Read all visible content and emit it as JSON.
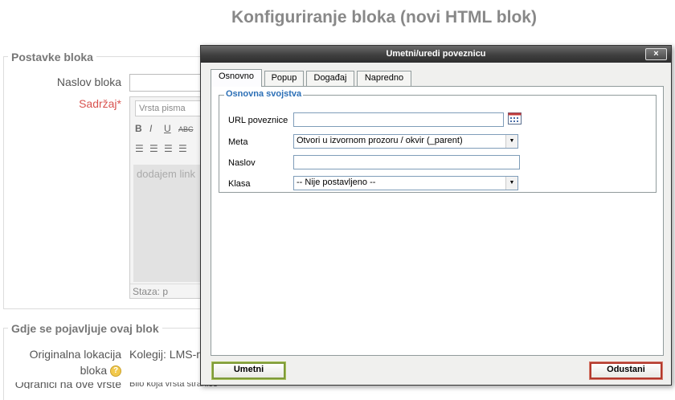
{
  "page": {
    "title": "Konfiguriranje bloka (novi HTML blok)",
    "section1_legend": "Postavke bloka",
    "block_title_label": "Naslov bloka",
    "content_label": "Sadržaj",
    "required_mark": "*",
    "font_select": "Vrsta pisma",
    "editor_text": "dodajem link",
    "editor_path": "Staza: p",
    "toolbar_row1": [
      "B",
      "I",
      "U",
      "ABC"
    ],
    "toolbar_row2": [
      "☰",
      "☰",
      "☰",
      "☰"
    ],
    "section2_legend": "Gdje se pojavljuje ovaj blok",
    "original_location_label_1": "Originalna lokacija",
    "original_location_label_2": "bloka",
    "original_location_value": "Kolegij: LMS-r",
    "help_glyph": "?",
    "cut_label": "Ograniči na ove vrste",
    "cut_value": "Bilo koja vrsta stranice"
  },
  "dialog": {
    "title": "Umetni/uredi poveznicu",
    "close_label": "×",
    "tabs": [
      "Osnovno",
      "Popup",
      "Događaj",
      "Napredno"
    ],
    "active_tab": 0,
    "fieldset_legend": "Osnovna svojstva",
    "url_label": "URL poveznice",
    "url_value": "",
    "target_label": "Meta",
    "target_value": "Otvori u izvornom prozoru / okvir (_parent)",
    "title_label": "Naslov",
    "title_value": "",
    "class_label": "Klasa",
    "class_value": "-- Nije postavljeno --",
    "insert_button": "Umetni",
    "cancel_button": "Odustani"
  },
  "colors": {
    "legend_blue": "#2b6fb6",
    "insert_border": "#7e9a38",
    "cancel_border": "#b3392c",
    "required": "#d9534f"
  }
}
